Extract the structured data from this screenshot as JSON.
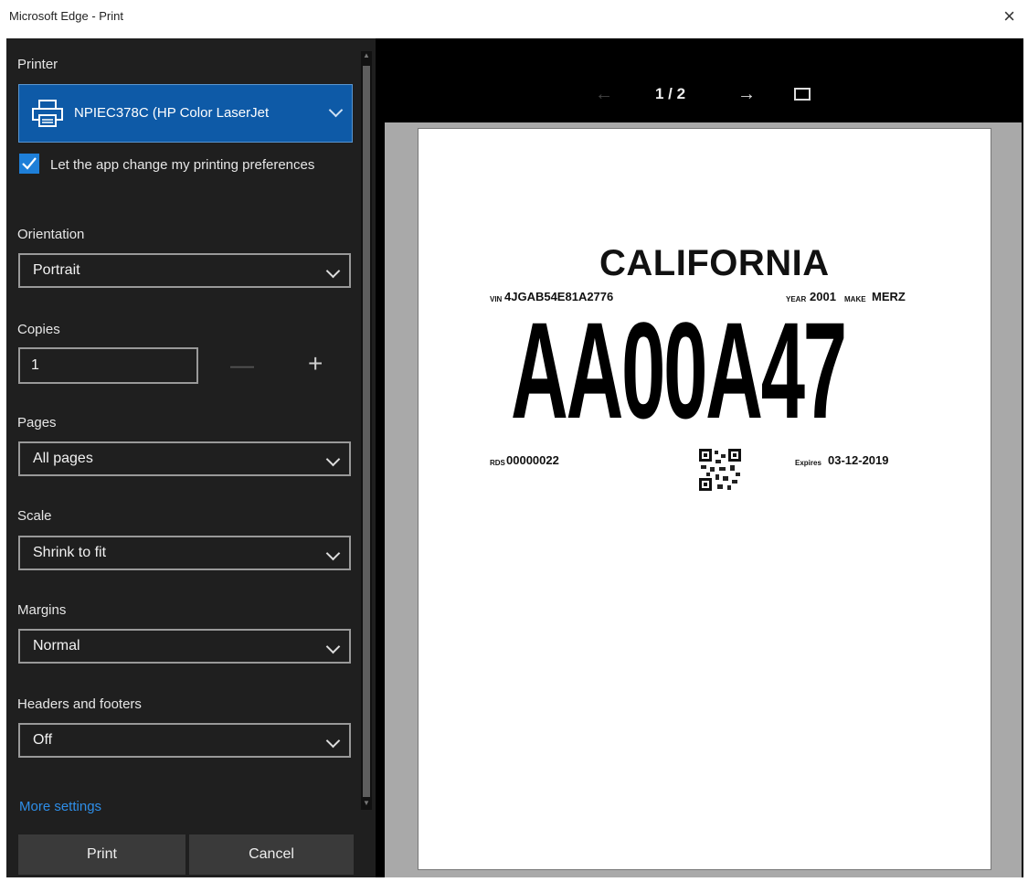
{
  "window": {
    "title": "Microsoft Edge - Print",
    "close_icon": "×"
  },
  "settings": {
    "printer_label": "Printer",
    "printer_value": "NPIEC378C (HP Color LaserJet",
    "app_prefs_checked": true,
    "app_prefs_label": "Let the app change my printing preferences",
    "orientation_label": "Orientation",
    "orientation_value": "Portrait",
    "copies_label": "Copies",
    "copies_value": "1",
    "pages_label": "Pages",
    "pages_value": "All pages",
    "scale_label": "Scale",
    "scale_value": "Shrink to fit",
    "margins_label": "Margins",
    "margins_value": "Normal",
    "headers_label": "Headers and footers",
    "headers_value": "Off",
    "more_settings": "More settings"
  },
  "buttons": {
    "print": "Print",
    "cancel": "Cancel"
  },
  "preview": {
    "page_indicator": "1 / 2",
    "prev_icon": "←",
    "next_icon": "→",
    "document": {
      "state": "CALIFORNIA",
      "vin_label": "VIN",
      "vin": "4JGAB54E81A2776",
      "year_label": "YEAR",
      "year": "2001",
      "make_label": "MAKE",
      "make": "MERZ",
      "plate": "AA00A47",
      "rds_label": "RDS",
      "rds": "00000022",
      "expires_label": "Expires",
      "expires": "03-12-2019"
    }
  },
  "colors": {
    "panel_bg": "#1f1f1f",
    "accent_blue": "#0e5aa7",
    "checkbox_blue": "#1e7fd8",
    "link_blue": "#2e8ee8"
  }
}
